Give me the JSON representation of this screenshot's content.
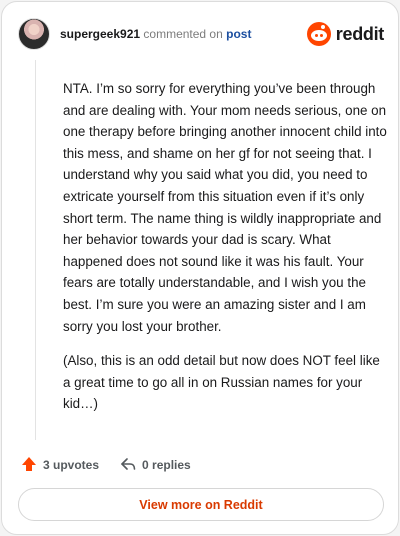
{
  "header": {
    "username": "supergeek921",
    "commented_text": "commented on",
    "post_link": "post",
    "brand": "reddit"
  },
  "comment": {
    "paragraphs": [
      "NTA. I’m so sorry for everything you’ve been through and are dealing with. Your mom needs serious, one on one therapy before bringing another innocent child into this mess, and shame on her gf for not seeing that. I understand why you said what you did, you need to extricate yourself from this situation even if it’s only short term. The name thing is wildly inappropriate and her behavior towards your dad is scary. What happened does not sound like it was his fault. Your fears are totally understandable, and I wish you the best. I’m sure you were an amazing sister and I am sorry you lost your brother.",
      "(Also, this is an odd detail but now does NOT feel like a great time to go all in on Russian names for your kid…)"
    ]
  },
  "actions": {
    "upvotes": "3 upvotes",
    "replies": "0 replies"
  },
  "footer": {
    "view_more": "View more on Reddit"
  },
  "colors": {
    "accent": "#ff4500",
    "link": "#1c4fa0",
    "view_more": "#d93a00"
  },
  "icons": {
    "avatar": "user-avatar",
    "brand": "reddit-snoo-icon",
    "upvote": "upvote-arrow-icon",
    "reply": "reply-arrow-icon"
  }
}
